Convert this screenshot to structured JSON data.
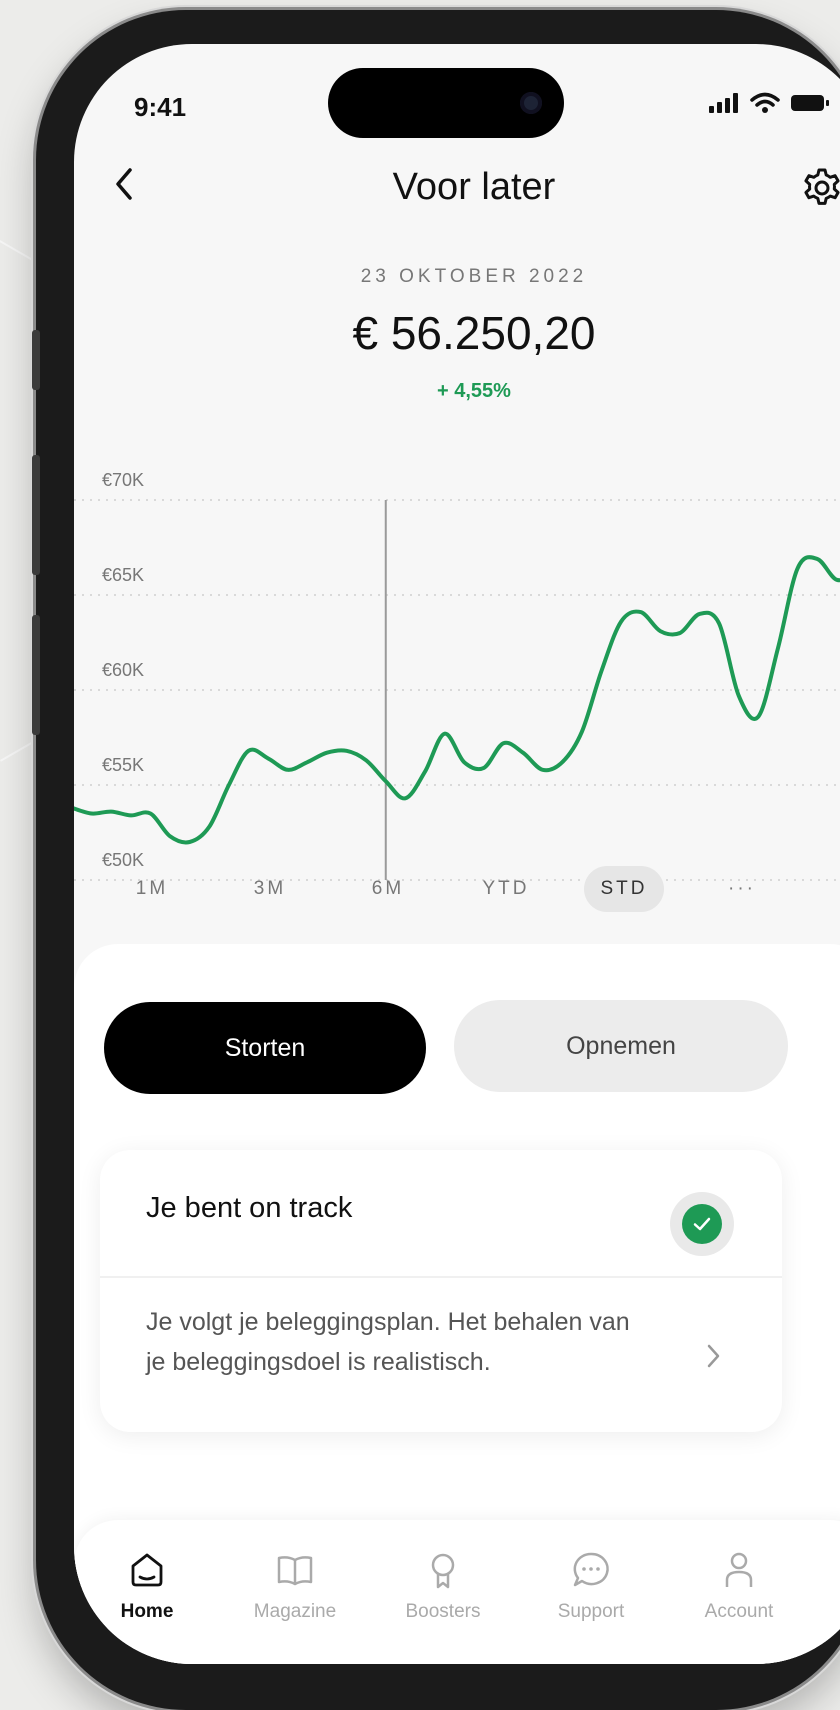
{
  "status_bar": {
    "time": "9:41"
  },
  "header": {
    "title": "Voor later",
    "back_icon": "chevron-left-icon",
    "settings_icon": "gear-icon"
  },
  "summary": {
    "date": "23 OKTOBER 2022",
    "value": "€ 56.250,20",
    "change": "+ 4,55%"
  },
  "colors": {
    "accent_green": "#1e9a55",
    "primary_button": "#000000",
    "secondary_button": "#ececec"
  },
  "chart_data": {
    "type": "line",
    "yticks": [
      "€70K",
      "€65K",
      "€60K",
      "€55K",
      "€50K"
    ],
    "ylim": [
      50000,
      70000
    ],
    "grid": true,
    "values": [
      53800,
      53500,
      53600,
      53400,
      53500,
      52300,
      52000,
      52800,
      55000,
      56800,
      56400,
      55800,
      56200,
      56700,
      56800,
      56300,
      55200,
      54300,
      55700,
      57700,
      56200,
      55900,
      57200,
      56700,
      55800,
      56200,
      57800,
      61000,
      63600,
      64100,
      63100,
      63000,
      64000,
      63500,
      59700,
      58600,
      62200,
      66400,
      66900,
      65800,
      66200,
      67200
    ],
    "marker_index": 16
  },
  "ranges": [
    {
      "label": "1M",
      "active": false
    },
    {
      "label": "3M",
      "active": false
    },
    {
      "label": "6M",
      "active": false
    },
    {
      "label": "YTD",
      "active": false
    },
    {
      "label": "STD",
      "active": true
    },
    {
      "label": "···",
      "active": false
    }
  ],
  "actions": {
    "deposit": "Storten",
    "withdraw": "Opnemen"
  },
  "status_card": {
    "title": "Je bent on track",
    "text": "Je volgt je beleggingsplan. Het behalen van je beleggingsdoel is realistisch."
  },
  "tabs": [
    {
      "label": "Home",
      "icon": "home-icon",
      "active": true
    },
    {
      "label": "Magazine",
      "icon": "book-icon",
      "active": false
    },
    {
      "label": "Boosters",
      "icon": "award-icon",
      "active": false
    },
    {
      "label": "Support",
      "icon": "chat-icon",
      "active": false
    },
    {
      "label": "Account",
      "icon": "user-icon",
      "active": false
    }
  ]
}
